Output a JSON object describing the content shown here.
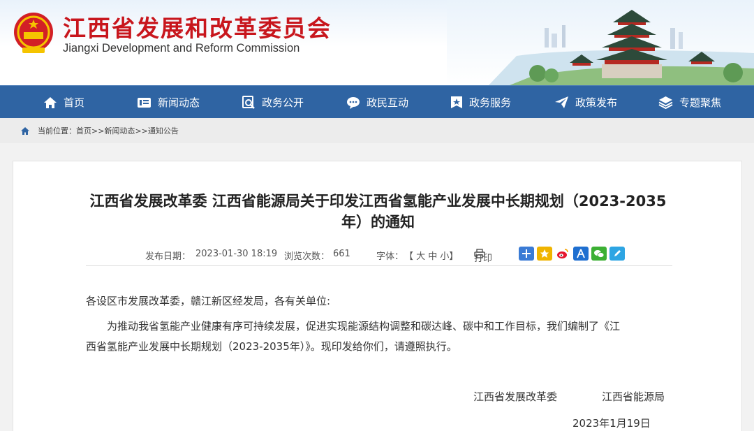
{
  "site": {
    "title": "江西省发展和改革委员会",
    "subtitle": "Jiangxi Development and Reform Commission"
  },
  "nav": [
    {
      "label": "首页",
      "icon": "home-icon"
    },
    {
      "label": "新闻动态",
      "icon": "news-icon"
    },
    {
      "label": "政务公开",
      "icon": "gov-open-icon"
    },
    {
      "label": "政民互动",
      "icon": "chat-icon"
    },
    {
      "label": "政务服务",
      "icon": "star-badge-icon"
    },
    {
      "label": "政策发布",
      "icon": "paper-plane-icon"
    },
    {
      "label": "专题聚焦",
      "icon": "layers-icon"
    }
  ],
  "breadcrumb": {
    "prefix": "当前位置：",
    "items": [
      "首页",
      "新闻动态",
      "通知公告"
    ],
    "separator": ">>"
  },
  "article": {
    "title": "江西省发展改革委 江西省能源局关于印发江西省氢能产业发展中长期规划（2023-2035年）的通知",
    "publish_label": "发布日期：",
    "publish_date": "2023-01-30 18:19",
    "views_label": "浏览次数：",
    "views": "661",
    "font_label": "字体：",
    "font_sizes": "【 大 中 小】",
    "print_label": "打印",
    "salutation": "各设区市发展改革委，赣江新区经发局，各有关单位:",
    "paragraph_line1": "为推动我省氢能产业健康有序可持续发展，促进实现能源结构调整和碳达峰、碳中和工作目标，我们编制了《江",
    "paragraph_line2": "西省氢能产业发展中长期规划（2023-2035年）》。现印发给你们，请遵照执行。",
    "signer1": "江西省发展改革委",
    "signer2": "江西省能源局",
    "date": "2023年1月19日"
  },
  "share_icons": [
    "plus-share-icon",
    "qzone-icon",
    "weibo-icon",
    "renren-icon",
    "wechat-icon",
    "edit-share-icon"
  ],
  "colors": {
    "brand_red": "#c8161d",
    "nav_blue": "#2f64a3"
  }
}
